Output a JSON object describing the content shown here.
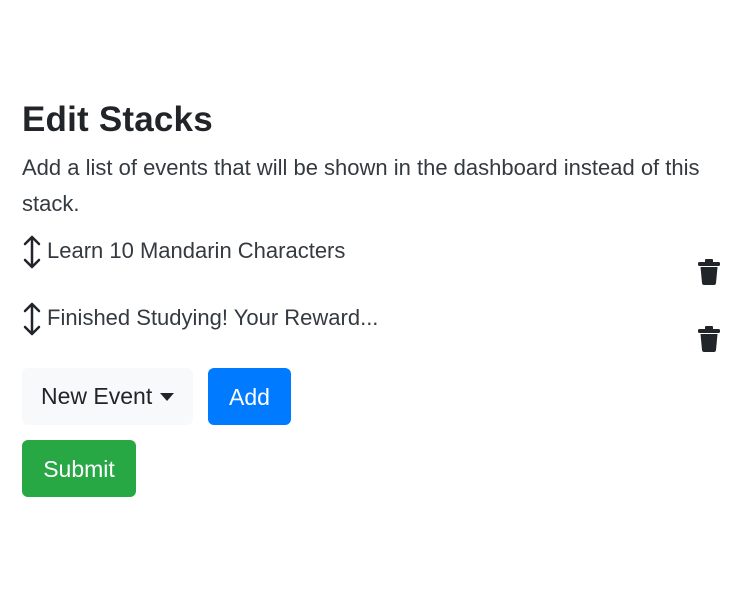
{
  "page": {
    "title": "Edit Stacks",
    "description": "Add a list of events that will be shown in the dashboard instead of this stack."
  },
  "events": [
    {
      "label": "Learn 10 Mandarin Characters",
      "drag_icon": "vertical-arrows-icon",
      "delete_icon": "trash-icon"
    },
    {
      "label": "Finished Studying! Your Reward...",
      "drag_icon": "vertical-arrows-icon",
      "delete_icon": "trash-icon"
    }
  ],
  "controls": {
    "event_type": {
      "selected": "New Event",
      "icon": "caret-down-icon"
    },
    "add_label": "Add",
    "submit_label": "Submit"
  },
  "colors": {
    "text": "#212529",
    "secondary_button": "#f8f9fa",
    "primary_button": "#007bff",
    "success_button": "#28a745"
  }
}
